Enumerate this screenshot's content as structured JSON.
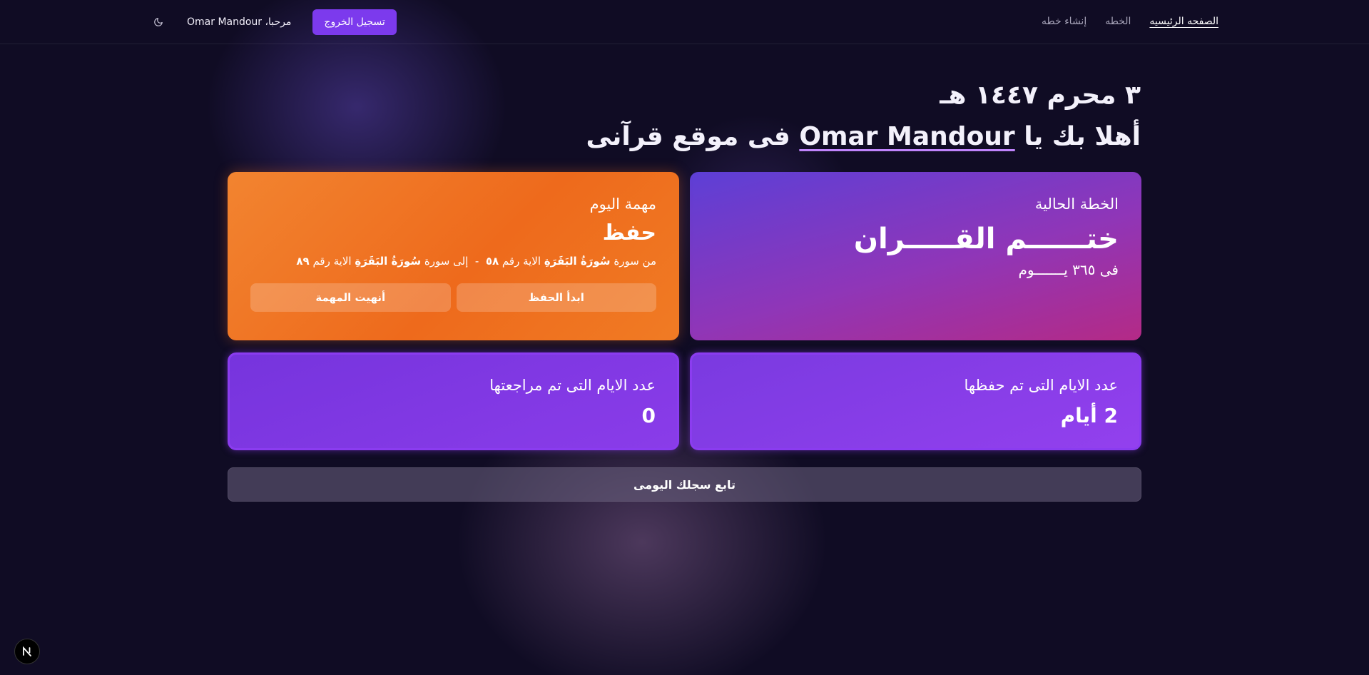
{
  "nav": {
    "items": [
      {
        "label": "الصفحه الرئيسيه",
        "active": true
      },
      {
        "label": "الخطه",
        "active": false
      },
      {
        "label": "إنشاء خطه",
        "active": false
      }
    ]
  },
  "user": {
    "greeting": "مرحبا، Omar Mandour",
    "logout_label": "تسجيل الخروج",
    "theme_icon": "moon-icon"
  },
  "hero": {
    "hijri_date": "٣ محرم ١٤٤٧ هـ",
    "welcome_prefix": "أهلا بك يا ",
    "user_name": "Omar Mandour",
    "welcome_suffix": " فى موقع قرآنى"
  },
  "plan_card": {
    "label": "الخطة الحالية",
    "plan_name": "ختــــــم القـــــران",
    "duration": "فى ٣٦٥ يـــــــوم"
  },
  "task_card": {
    "label": "مهمة اليوم",
    "task_type": "حفظ",
    "from_text": "من سورة",
    "from_surah": "سُورَةُ البَقَرَةِ",
    "from_ayah_text": "الاية رقم",
    "from_ayah": "٥٨",
    "separator": "-",
    "to_text": "إلى سورة",
    "to_surah": "سُورَةُ البَقَرَةِ",
    "to_ayah_text": "الاية رقم",
    "to_ayah": "٨٩",
    "start_label": "ابدأ الحفظ",
    "finish_label": "أنهيت المهمة"
  },
  "stats": {
    "memorized_label": "عدد الايام التى تم حفظها",
    "memorized_value": "2 أيام",
    "reviewed_label": "عدد الايام التى تم مراجعتها",
    "reviewed_value": "0"
  },
  "follow_label": "تابع سجلك اليومى",
  "dev_badge": "N",
  "colors": {
    "accent": "#7c3aed",
    "task_card": "#ee6a1c",
    "stat_card": "#7a36e2",
    "background": "#100c24"
  }
}
